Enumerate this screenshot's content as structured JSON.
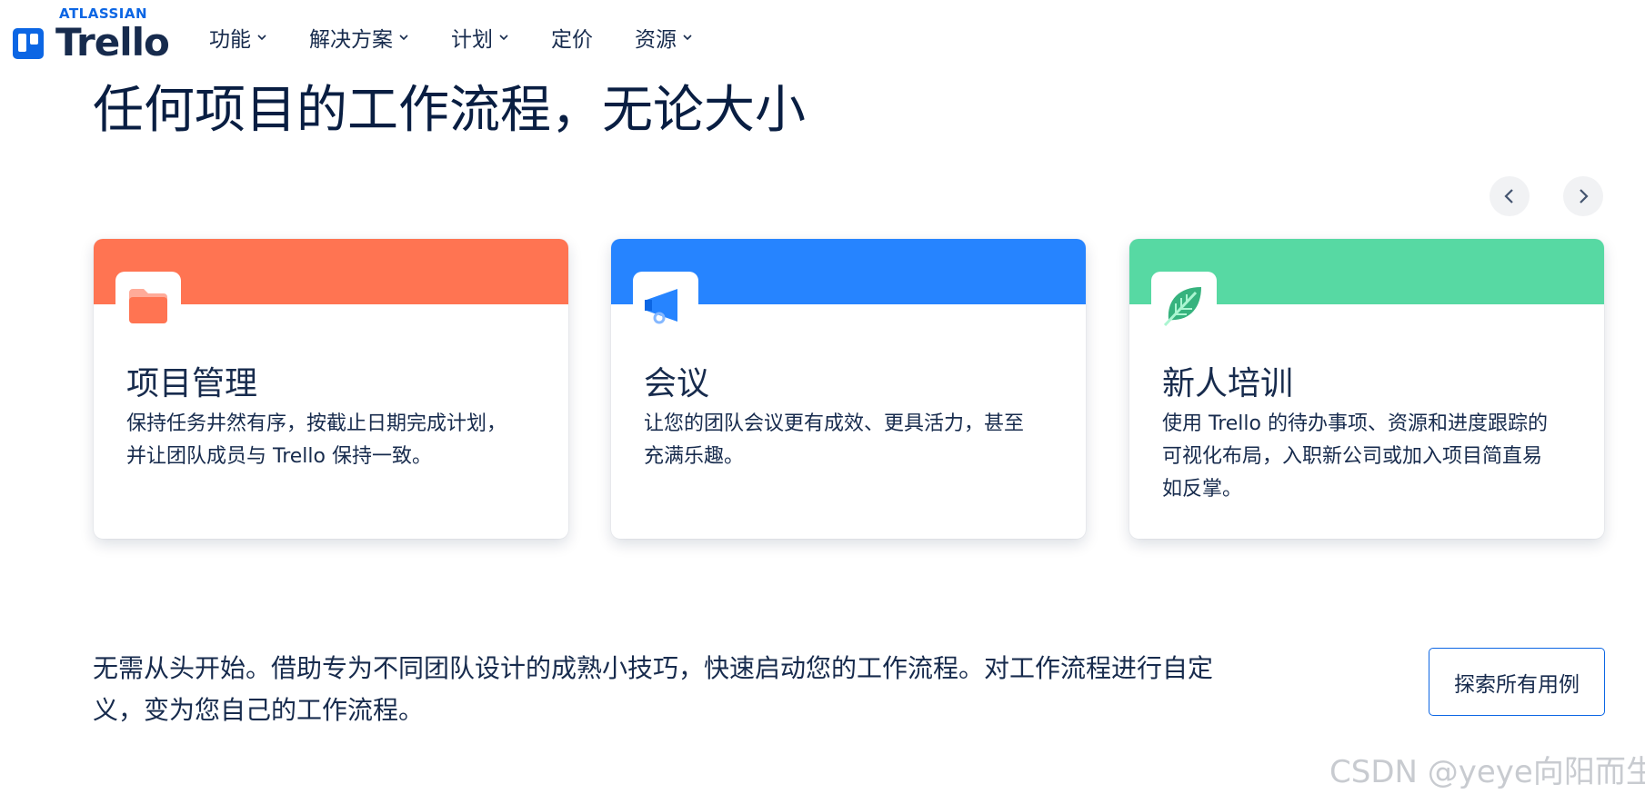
{
  "header": {
    "brand_small": "ATLASSIAN",
    "brand_name": "Trello",
    "nav": [
      {
        "label": "功能",
        "has_dropdown": true
      },
      {
        "label": "解决方案",
        "has_dropdown": true
      },
      {
        "label": "计划",
        "has_dropdown": true
      },
      {
        "label": "定价",
        "has_dropdown": false
      },
      {
        "label": "资源",
        "has_dropdown": true
      }
    ]
  },
  "hero": {
    "title": "任何项目的工作流程，无论大小"
  },
  "carousel": {
    "prev_icon": "chevron-left-icon",
    "next_icon": "chevron-right-icon",
    "cards": [
      {
        "title": "项目管理",
        "description": "保持任务井然有序，按截止日期完成计划，并让团队成员与 Trello 保持一致。",
        "accent": "#ff7452",
        "icon": "folder-icon"
      },
      {
        "title": "会议",
        "description": "让您的团队会议更有成效、更具活力，甚至充满乐趣。",
        "accent": "#2684ff",
        "icon": "megaphone-icon"
      },
      {
        "title": "新人培训",
        "description": "使用 Trello 的待办事项、资源和进度跟踪的可视化布局，入职新公司或加入项目简直易如反掌。",
        "accent": "#57d9a3",
        "icon": "leaf-icon"
      }
    ]
  },
  "bottom": {
    "text": "无需从头开始。借助专为不同团队设计的成熟小技巧，快速启动您的工作流程。对工作流程进行自定义，变为您自己的工作流程。",
    "button_label": "探索所有用例"
  },
  "watermark": "CSDN @yeye向阳而生",
  "colors": {
    "brand": "#0c66e4",
    "text": "#172b4d"
  }
}
